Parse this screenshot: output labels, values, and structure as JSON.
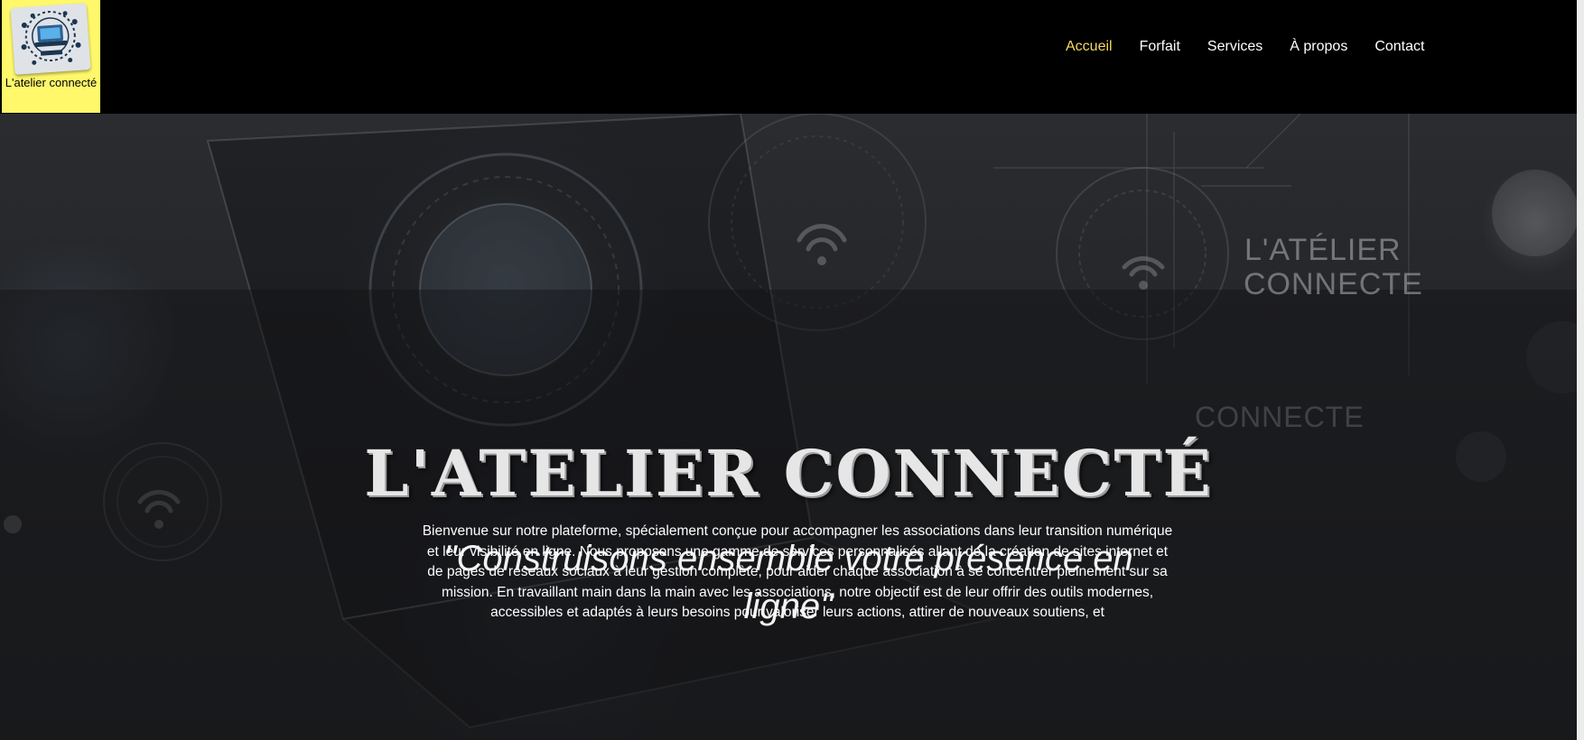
{
  "brand": {
    "logo_caption": "L'atelier connecté",
    "colors": {
      "logo_bg": "#fff86b",
      "header_bg": "#000000",
      "nav_active": "#f6d85e"
    }
  },
  "nav": {
    "items": [
      {
        "label": "Accueil",
        "active": true
      },
      {
        "label": "Forfait",
        "active": false
      },
      {
        "label": "Services",
        "active": false
      },
      {
        "label": "À propos",
        "active": false
      },
      {
        "label": "Contact",
        "active": false
      }
    ]
  },
  "hero": {
    "background_text_1": "L'ATÉLIER",
    "background_text_2": "CONNECTE",
    "background_text_3": "CONNECTE",
    "title": "L'ATELIER CONNECTÉ",
    "tagline": "\"Construisons ensemble votre présence en ligne\"",
    "intro": "Bienvenue sur notre plateforme, spécialement conçue pour accompagner les associations dans leur transition numérique et leur visibilité en ligne. Nous proposons une gamme de services personnalisés allant de la création de sites internet et de pages de réseaux sociaux à leur gestion complète, pour aider chaque association à se concentrer pleinement sur sa mission. En travaillant main dans la main avec les associations, notre objectif est de leur offrir des outils modernes, accessibles et adaptés à leurs besoins pour valoriser leurs actions, attirer de nouveaux soutiens, et"
  }
}
